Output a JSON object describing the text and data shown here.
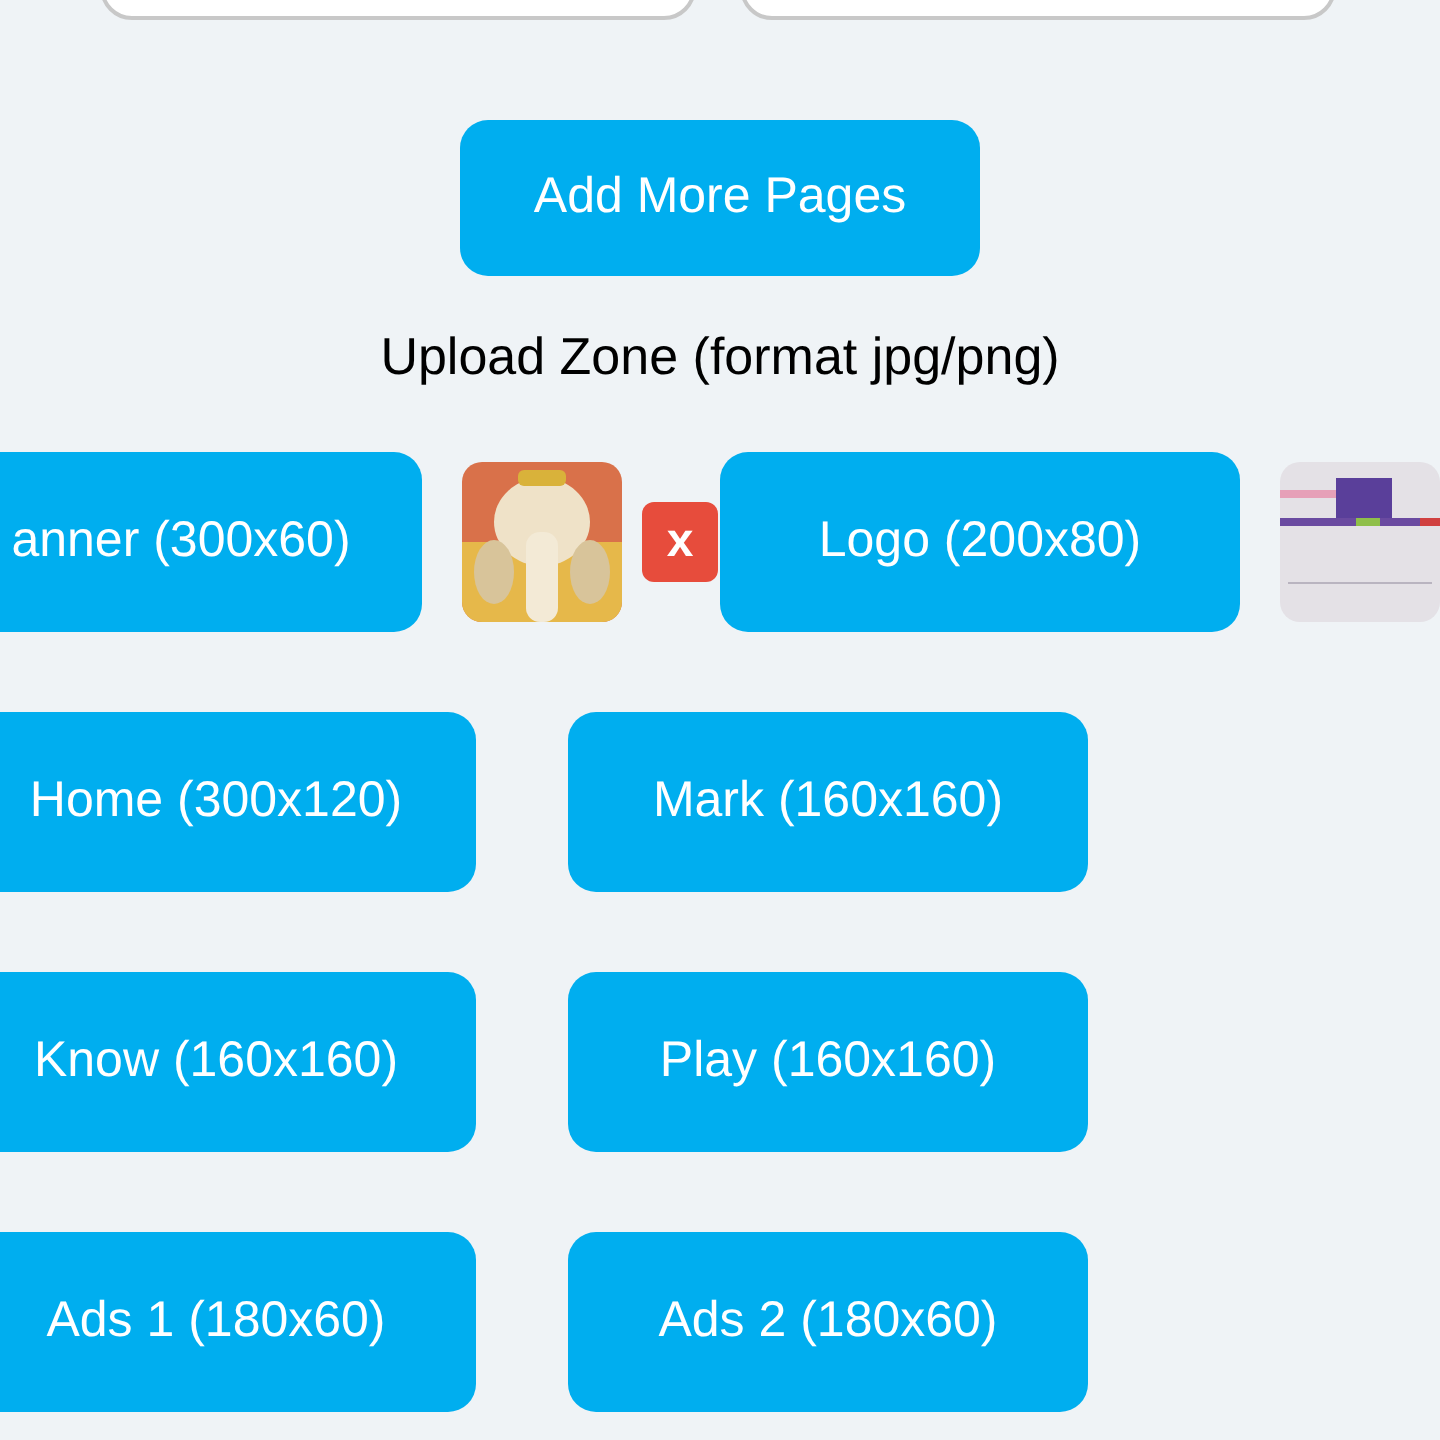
{
  "fields": [
    {
      "kind": "text"
    },
    {
      "kind": "text"
    }
  ],
  "add_pages_button": "Add More Pages",
  "upload_zone_label": "Upload Zone (format jpg/png)",
  "upload_rows": [
    [
      {
        "kind": "button",
        "label": "anner (300x60)"
      },
      {
        "kind": "picture"
      },
      {
        "kind": "remove",
        "label": "x"
      },
      {
        "kind": "button",
        "label": "Logo (200x80)"
      },
      {
        "kind": "picture"
      }
    ],
    [
      {
        "kind": "button",
        "label": "Home (300x120)"
      },
      {
        "kind": "button",
        "label": "Mark (160x160)"
      }
    ],
    [
      {
        "kind": "button",
        "label": "Know (160x160)"
      },
      {
        "kind": "button",
        "label": "Play (160x160)"
      }
    ],
    [
      {
        "kind": "button",
        "label": "Ads 1 (180x60)"
      },
      {
        "kind": "button",
        "label": "Ads 2 (180x60)"
      }
    ]
  ]
}
